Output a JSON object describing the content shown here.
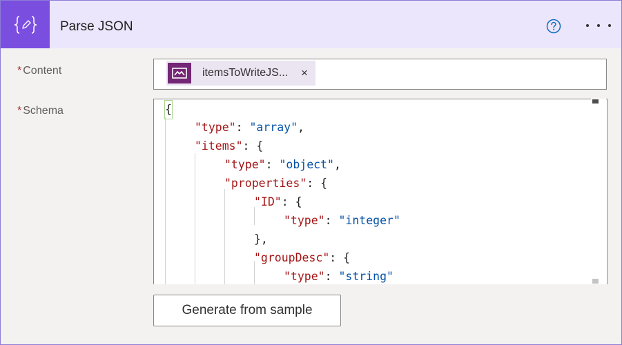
{
  "header": {
    "title": "Parse JSON",
    "accent_color": "#7a4fe0",
    "icon": "curly-braces-pencil-icon",
    "help_icon": "question-circle-icon",
    "more_icon": "ellipsis-icon"
  },
  "content_field": {
    "required_mark": "*",
    "label": "Content",
    "token": {
      "label": "itemsToWriteJS...",
      "icon": "power-apps-icon",
      "icon_color": "#742774",
      "remove_label": "×"
    }
  },
  "schema_field": {
    "required_mark": "*",
    "label": "Schema",
    "code_lines": [
      {
        "open": "{"
      },
      {
        "key": "\"type\"",
        "value": "\"array\"",
        "end": ","
      },
      {
        "key": "\"items\"",
        "end": " {"
      },
      {
        "key": "\"type\"",
        "value": "\"object\"",
        "end": ","
      },
      {
        "key": "\"properties\"",
        "end": " {"
      },
      {
        "key": "\"ID\"",
        "end": " {"
      },
      {
        "key": "\"type\"",
        "value": "\"integer\"",
        "end": ""
      },
      {
        "text": "},"
      },
      {
        "key": "\"groupDesc\"",
        "end": " {"
      },
      {
        "key": "\"type\"",
        "value": "\"string\"",
        "end": ""
      }
    ]
  },
  "generate_button": {
    "label": "Generate from sample"
  }
}
